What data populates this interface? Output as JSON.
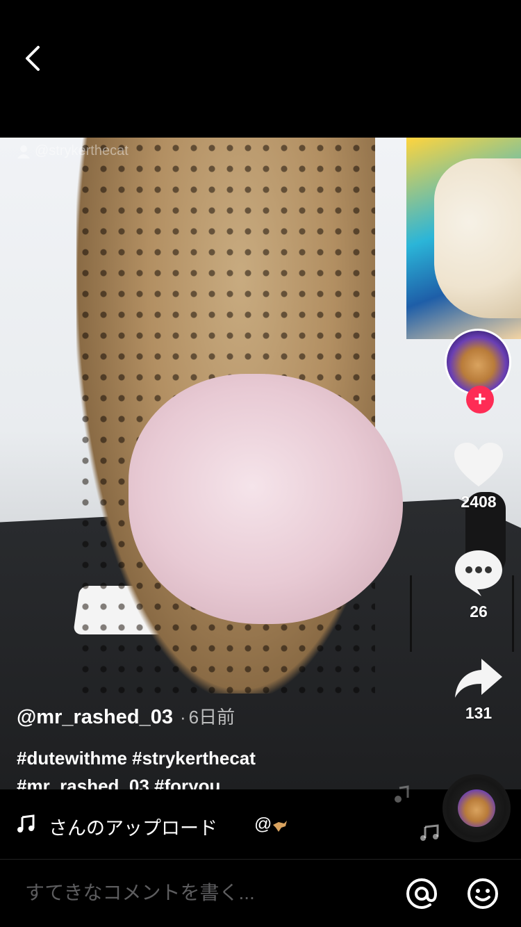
{
  "watermark": {
    "text": "@strykerthecat"
  },
  "sidebar": {
    "likes": "2408",
    "comments": "26",
    "shares": "131",
    "follow_icon": "+"
  },
  "caption": {
    "username": "@mr_rashed_03",
    "separator": "·",
    "time": "6日前",
    "hashtags_line1": "#dutewithme #strykerthecat",
    "hashtags_line2": "#mr_rashed_03 #foryou"
  },
  "music": {
    "text": "さんのアップロード",
    "author": "@"
  },
  "comment": {
    "placeholder": "すてきなコメントを書く..."
  },
  "colors": {
    "follow": "#fe2c55",
    "background": "#000000"
  },
  "icons": [
    "back-icon",
    "heart-icon",
    "comment-icon",
    "share-icon",
    "music-note-icon",
    "at-icon",
    "emoji-icon"
  ]
}
